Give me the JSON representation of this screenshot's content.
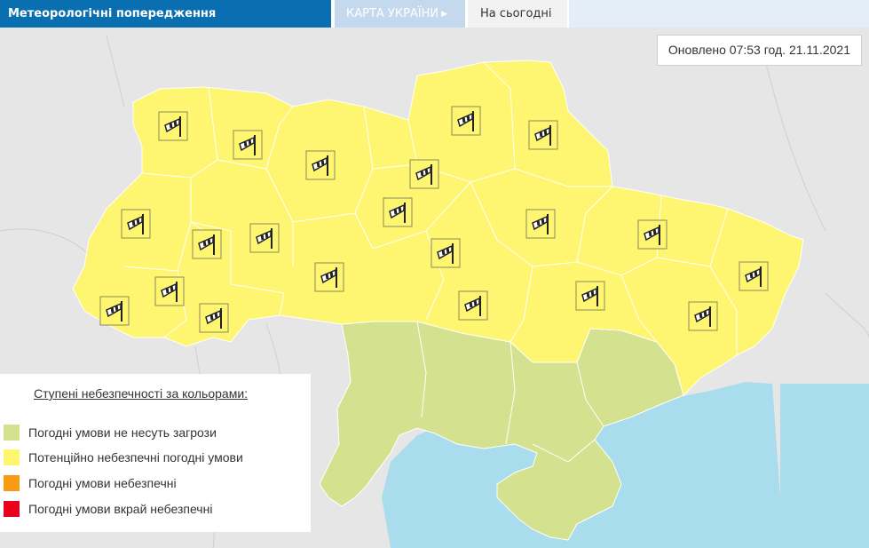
{
  "header": {
    "title": "Метеорологічні попередження",
    "tabs": [
      {
        "label": "КАРТА УКРАЇНИ",
        "active": true
      },
      {
        "label": "На сьогодні",
        "active": false
      }
    ]
  },
  "updated_text": "Оновлено 07:53 год. 21.11.2021",
  "legend": {
    "title": "Ступені небезпечності за кольорами:",
    "items": [
      {
        "label": "Погодні умови не несуть загрози",
        "color": "#d4e28f"
      },
      {
        "label": "Потенційно небезпечні погодні умови",
        "color": "#fef570"
      },
      {
        "label": "Погодні умови небезпечні",
        "color": "#f99a15"
      },
      {
        "label": "Погодні умови вкрай небезпечні",
        "color": "#e8001c"
      }
    ]
  },
  "colors": {
    "brand": "#0a6fb0",
    "sea": "#a9dcec",
    "neighbors": "#e6e6e6",
    "warning_yellow": "#fef570",
    "safe_green": "#d4e28f"
  },
  "map": {
    "warning_icon": "windsock-icon",
    "warning_type": "wind"
  }
}
